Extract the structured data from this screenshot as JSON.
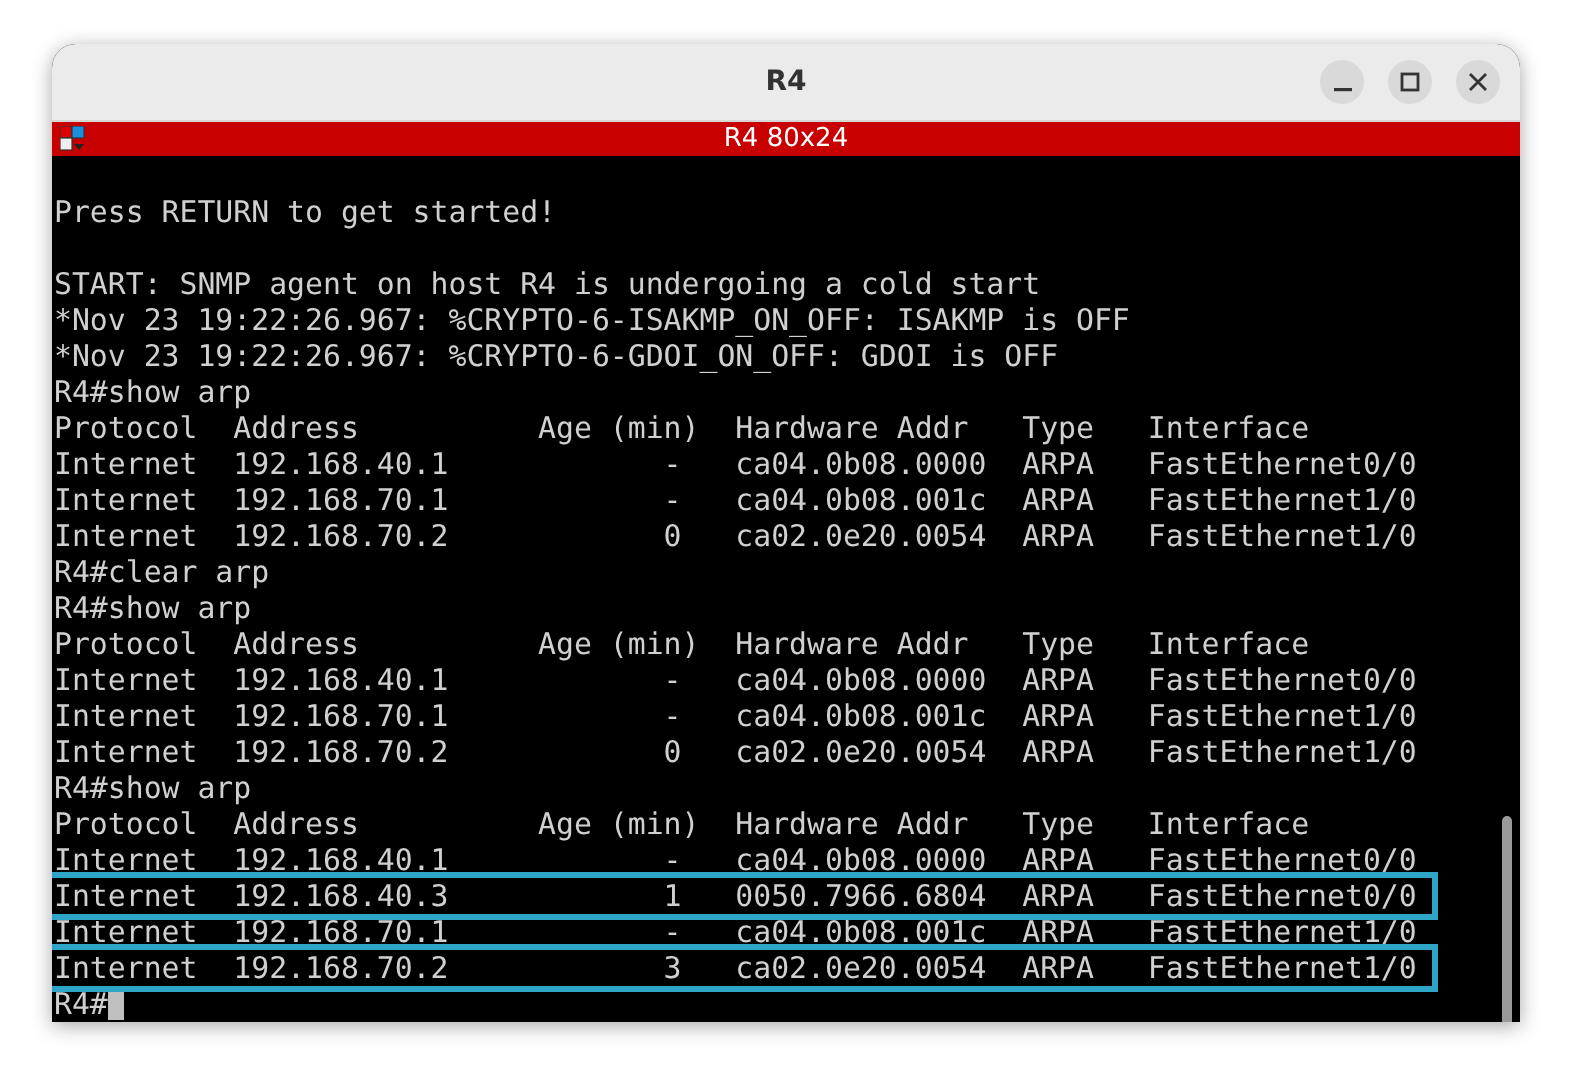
{
  "window": {
    "title": "R4"
  },
  "terminal": {
    "title": "R4 80x24",
    "prompt": "R4#",
    "blocks": [
      [
        {
          "text": "Press RETURN to get started!",
          "highlighted": false
        }
      ],
      [
        {
          "text": "START: SNMP agent on host R4 is undergoing a cold start",
          "highlighted": false
        },
        {
          "text": "*Nov 23 19:22:26.967: %CRYPTO-6-ISAKMP_ON_OFF: ISAKMP is OFF",
          "highlighted": false
        },
        {
          "text": "*Nov 23 19:22:26.967: %CRYPTO-6-GDOI_ON_OFF: GDOI is OFF",
          "highlighted": false
        },
        {
          "text": "R4#show arp",
          "highlighted": false
        },
        {
          "text": "Protocol  Address          Age (min)  Hardware Addr   Type   Interface",
          "highlighted": false
        },
        {
          "text": "Internet  192.168.40.1            -   ca04.0b08.0000  ARPA   FastEthernet0/0",
          "highlighted": false
        },
        {
          "text": "Internet  192.168.70.1            -   ca04.0b08.001c  ARPA   FastEthernet1/0",
          "highlighted": false
        },
        {
          "text": "Internet  192.168.70.2            0   ca02.0e20.0054  ARPA   FastEthernet1/0",
          "highlighted": false
        },
        {
          "text": "R4#clear arp",
          "highlighted": false
        },
        {
          "text": "R4#show arp",
          "highlighted": false
        },
        {
          "text": "Protocol  Address          Age (min)  Hardware Addr   Type   Interface",
          "highlighted": false
        },
        {
          "text": "Internet  192.168.40.1            -   ca04.0b08.0000  ARPA   FastEthernet0/0",
          "highlighted": false
        },
        {
          "text": "Internet  192.168.70.1            -   ca04.0b08.001c  ARPA   FastEthernet1/0",
          "highlighted": false
        },
        {
          "text": "Internet  192.168.70.2            0   ca02.0e20.0054  ARPA   FastEthernet1/0",
          "highlighted": false
        },
        {
          "text": "R4#show arp",
          "highlighted": false
        },
        {
          "text": "Protocol  Address          Age (min)  Hardware Addr   Type   Interface",
          "highlighted": false
        },
        {
          "text": "Internet  192.168.40.1            -   ca04.0b08.0000  ARPA   FastEthernet0/0",
          "highlighted": false
        },
        {
          "text": "Internet  192.168.40.3            1   0050.7966.6804  ARPA   FastEthernet0/0",
          "highlighted": true
        },
        {
          "text": "Internet  192.168.70.1            -   ca04.0b08.001c  ARPA   FastEthernet1/0",
          "highlighted": false
        },
        {
          "text": "Internet  192.168.70.2            3   ca02.0e20.0054  ARPA   FastEthernet1/0",
          "highlighted": true
        }
      ]
    ]
  }
}
